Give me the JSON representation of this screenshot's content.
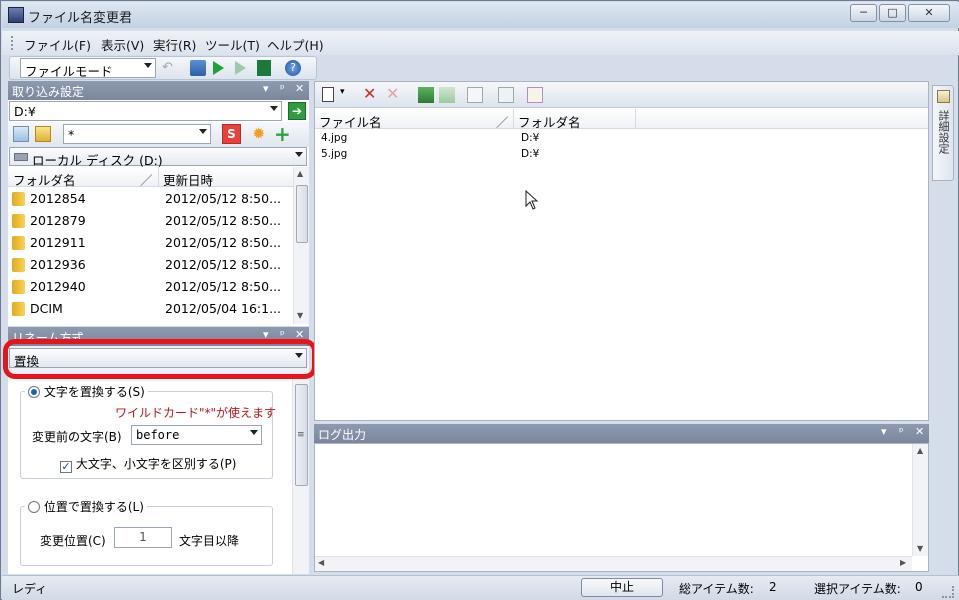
{
  "window": {
    "title": "ファイル名変更君"
  },
  "menu": [
    "ファイル(F)",
    "表示(V)",
    "実行(R)",
    "ツール(T)",
    "ヘルプ(H)"
  ],
  "toolbar": {
    "mode": "ファイルモード"
  },
  "import_panel": {
    "title": "取り込み設定",
    "path": "D:¥",
    "filter": "*",
    "drive": "ローカル ディスク (D:)",
    "columns": [
      "フォルダ名",
      "更新日時"
    ],
    "sort_mark": "／",
    "folders": [
      {
        "name": "2012854",
        "date": "2012/05/12 8:50..."
      },
      {
        "name": "2012879",
        "date": "2012/05/12 8:50..."
      },
      {
        "name": "2012911",
        "date": "2012/05/12 8:50..."
      },
      {
        "name": "2012936",
        "date": "2012/05/12 8:50..."
      },
      {
        "name": "2012940",
        "date": "2012/05/12 8:50..."
      },
      {
        "name": "DCIM",
        "date": "2012/05/04 16:1..."
      }
    ]
  },
  "rename_panel": {
    "title": "リネーム方式",
    "method": "置換",
    "replace_text": {
      "label": "文字を置換する(S)",
      "wildcard_note": "ワイルドカード\"*\"が使えます",
      "before_label": "変更前の文字(B)",
      "before_value": "before",
      "case_label": "大文字、小文字を区別する(P)"
    },
    "replace_pos": {
      "label": "位置で置換する(L)",
      "pos_label": "変更位置(C)",
      "pos_value": "1",
      "pos_suffix": "文字目以降"
    }
  },
  "file_list": {
    "columns": [
      "ファイル名",
      "フォルダ名"
    ],
    "sort_mark": "／",
    "files": [
      {
        "name": "4.jpg",
        "folder": "D:¥"
      },
      {
        "name": "5.jpg",
        "folder": "D:¥"
      }
    ]
  },
  "log_panel": {
    "title": "ログ出力"
  },
  "side_tab": {
    "label": "詳細設定"
  },
  "status": {
    "ready": "レディ",
    "stop": "中止",
    "total_label": "総アイテム数:",
    "total_value": "2",
    "selected_label": "選択アイテム数:",
    "selected_value": "0"
  },
  "colors": {
    "highlight": "#e8141a",
    "panel_header": "#7b879d",
    "note": "#c0141a"
  }
}
